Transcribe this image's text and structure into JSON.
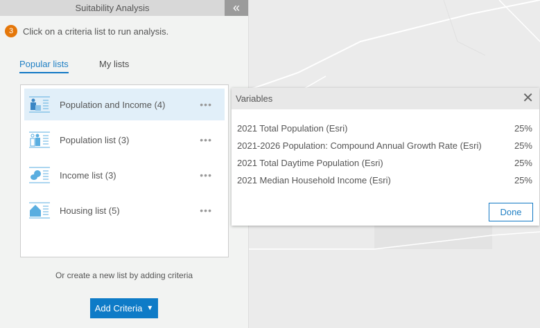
{
  "panel": {
    "title": "Suitability Analysis",
    "collapse_icon": "double-chevron-left-icon",
    "step_number": "3",
    "step_text": "Click on a criteria list to run analysis.",
    "tabs": [
      {
        "label": "Popular lists",
        "active": true
      },
      {
        "label": "My lists",
        "active": false
      }
    ],
    "lists": [
      {
        "label": "Population and Income (4)",
        "icon": "population-income-icon",
        "selected": true
      },
      {
        "label": "Population list (3)",
        "icon": "population-icon",
        "selected": false
      },
      {
        "label": "Income list (3)",
        "icon": "income-icon",
        "selected": false
      },
      {
        "label": "Housing list (5)",
        "icon": "housing-icon",
        "selected": false
      }
    ],
    "more_label": "•••",
    "create_text": "Or create a new list by adding criteria",
    "add_button": "Add Criteria"
  },
  "popup": {
    "title": "Variables",
    "close": "✕",
    "variables": [
      {
        "name": "2021 Total Population (Esri)",
        "weight": "25%"
      },
      {
        "name": "2021-2026 Population: Compound Annual Growth Rate (Esri)",
        "weight": "25%"
      },
      {
        "name": "2021 Total Daytime Population (Esri)",
        "weight": "25%"
      },
      {
        "name": "2021 Median Household Income (Esri)",
        "weight": "25%"
      }
    ],
    "done": "Done"
  },
  "colors": {
    "accent": "#0e7bc7",
    "badge": "#e5770a",
    "selected": "#e1eff9"
  }
}
